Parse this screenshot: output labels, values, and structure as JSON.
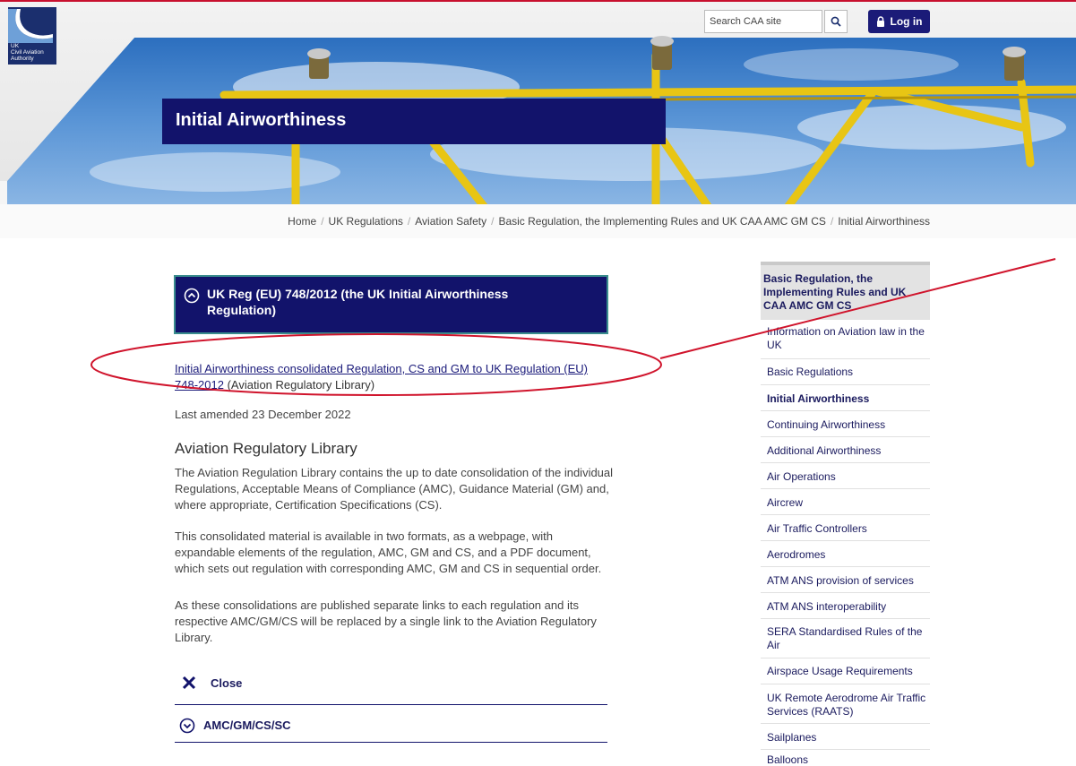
{
  "header": {
    "logo_text": [
      "UK",
      "Civil Aviation",
      "Authority"
    ],
    "search_placeholder": "Search CAA site",
    "login_label": "Log in",
    "page_title": "Initial Airworthiness"
  },
  "breadcrumb": [
    "Home",
    "UK Regulations",
    "Aviation Safety",
    "Basic Regulation, the Implementing Rules and UK CAA AMC GM CS",
    "Initial Airworthiness"
  ],
  "main": {
    "accordion_title": "UK Reg (EU) 748/2012 (the UK Initial Airworthiness Regulation)",
    "reg_link_text": "Initial Airworthiness consolidated Regulation, CS and GM to UK Regulation (EU) 748-2012",
    "reg_link_suffix": " (Aviation Regulatory Library)",
    "last_amended": "Last amended 23 December 2022",
    "section_heading": "Aviation Regulatory Library",
    "paragraphs": [
      "The Aviation Regulation Library contains the up to date consolidation of the individual Regulations, Acceptable Means of Compliance (AMC), Guidance Material (GM) and, where appropriate, Certification Specifications (CS).",
      "This consolidated material is available in two formats, as a webpage, with expandable elements of the regulation, AMC, GM and CS, and a PDF document, which sets out regulation with corresponding AMC, GM and CS in sequential order.",
      "As these consolidations are published separate links to each regulation and its respective AMC/GM/CS will be replaced by a single link to the Aviation Regulatory Library."
    ],
    "close_label": "Close",
    "amc_label": "AMC/GM/CS/SC"
  },
  "sidebar": {
    "heading": "Basic Regulation, the Implementing Rules and UK CAA AMC GM CS",
    "items": [
      {
        "label": "Information on Aviation law in the UK"
      },
      {
        "label": "Basic Regulations"
      },
      {
        "label": "Initial Airworthiness",
        "active": true
      },
      {
        "label": "Continuing Airworthiness"
      },
      {
        "label": "Additional Airworthiness"
      },
      {
        "label": "Air Operations"
      },
      {
        "label": "Aircrew"
      },
      {
        "label": "Air Traffic Controllers"
      },
      {
        "label": "Aerodromes"
      },
      {
        "label": "ATM ANS provision of services"
      },
      {
        "label": "ATM ANS interoperability"
      },
      {
        "label": "SERA Standardised Rules of the Air"
      },
      {
        "label": "Airspace Usage Requirements"
      },
      {
        "label": "UK Remote Aerodrome Air Traffic Services (RAATS)"
      },
      {
        "label": "Sailplanes"
      },
      {
        "label": "Balloons"
      }
    ]
  },
  "colors": {
    "navy": "#12136b",
    "annotation_red": "#d0142c",
    "link": "#1a1a7a"
  },
  "icons": [
    "caa-logo",
    "search-icon",
    "lock-icon",
    "chevron-up-circle-icon",
    "close-x-icon",
    "chevron-down-circle-icon"
  ]
}
